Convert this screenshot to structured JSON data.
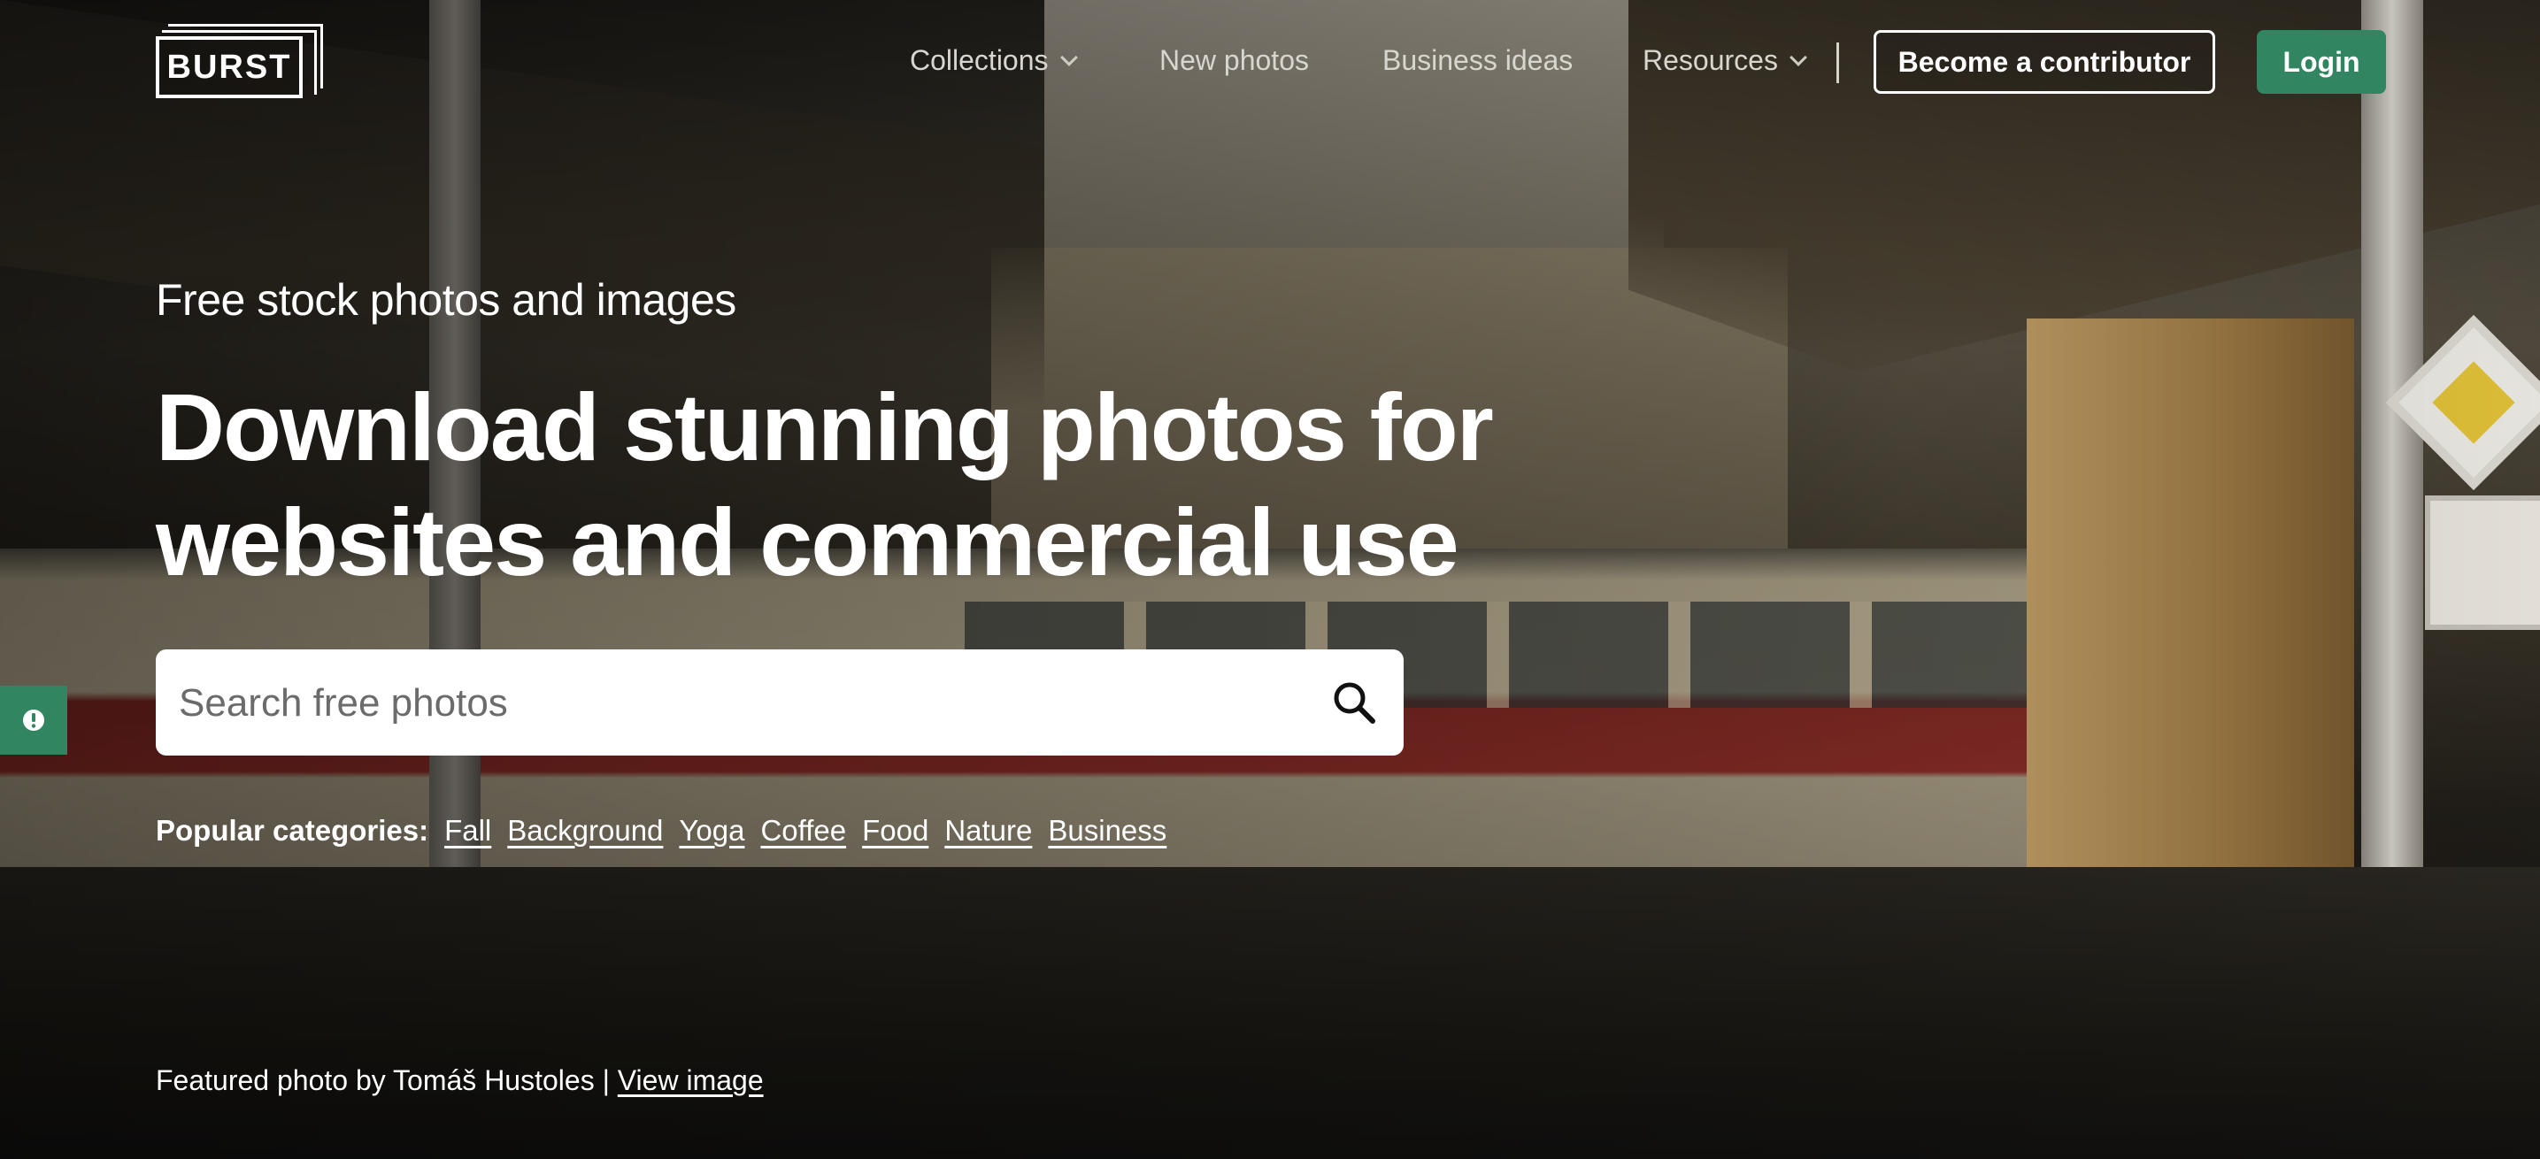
{
  "nav": {
    "logo_text": "BURST",
    "links": [
      {
        "label": "Collections",
        "has_dropdown": true
      },
      {
        "label": "New photos",
        "has_dropdown": false
      },
      {
        "label": "Business ideas",
        "has_dropdown": false
      },
      {
        "label": "Resources",
        "has_dropdown": true
      }
    ],
    "contributor_label": "Become a contributor",
    "login_label": "Login"
  },
  "hero": {
    "subtitle": "Free stock photos and images",
    "headline": "Download stunning photos for websites and commercial use",
    "search_placeholder": "Search free photos",
    "search_icon": "search-icon",
    "categories_label": "Popular categories:",
    "categories": [
      "Fall",
      "Background",
      "Yoga",
      "Coffee",
      "Food",
      "Nature",
      "Business"
    ],
    "featured_prefix": "Featured photo by Tomáš Hustoles | ",
    "featured_link": "View image"
  },
  "colors": {
    "accent_green": "#318561",
    "text_white": "#ffffff"
  },
  "feedback_icon": "exclamation-icon"
}
